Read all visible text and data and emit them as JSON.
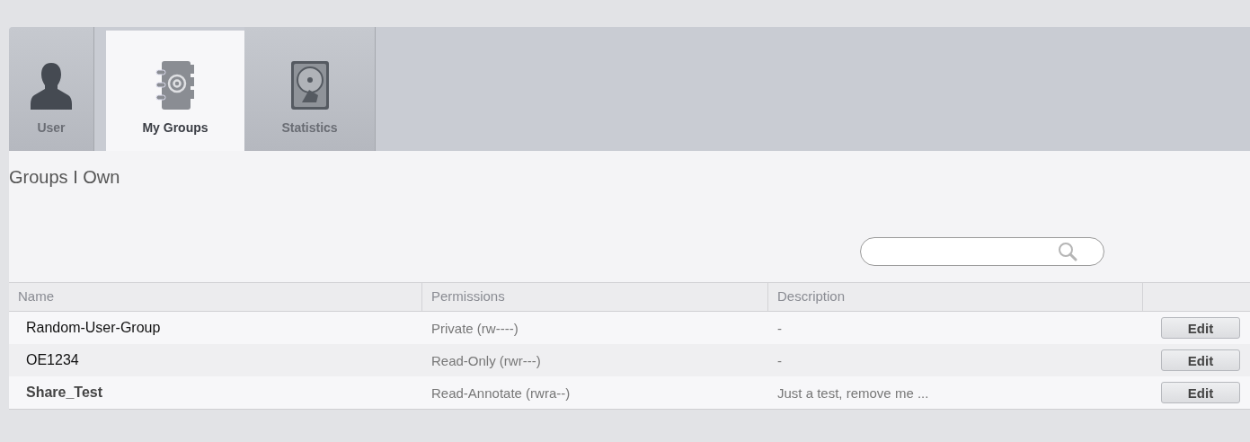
{
  "tabs": [
    {
      "kind": "user",
      "label": "User",
      "selected": false
    },
    {
      "kind": "groups",
      "label": "My Groups",
      "selected": true
    },
    {
      "kind": "statistics",
      "label": "Statistics",
      "selected": false
    }
  ],
  "section_title": "Groups I Own",
  "table": {
    "columns": [
      "Name",
      "Permissions",
      "Description"
    ],
    "rows": [
      {
        "name": "Random-User-Group",
        "bold": false,
        "permissions": "Private (rw----)",
        "description": "-",
        "action": "Edit"
      },
      {
        "name": "OE1234",
        "bold": false,
        "permissions": "Read-Only (rwr---)",
        "description": "-",
        "action": "Edit"
      },
      {
        "name": "Share_Test",
        "bold": true,
        "permissions": "Read-Annotate (rwra--)",
        "description": "Just a test, remove me ...",
        "action": "Edit"
      }
    ]
  }
}
